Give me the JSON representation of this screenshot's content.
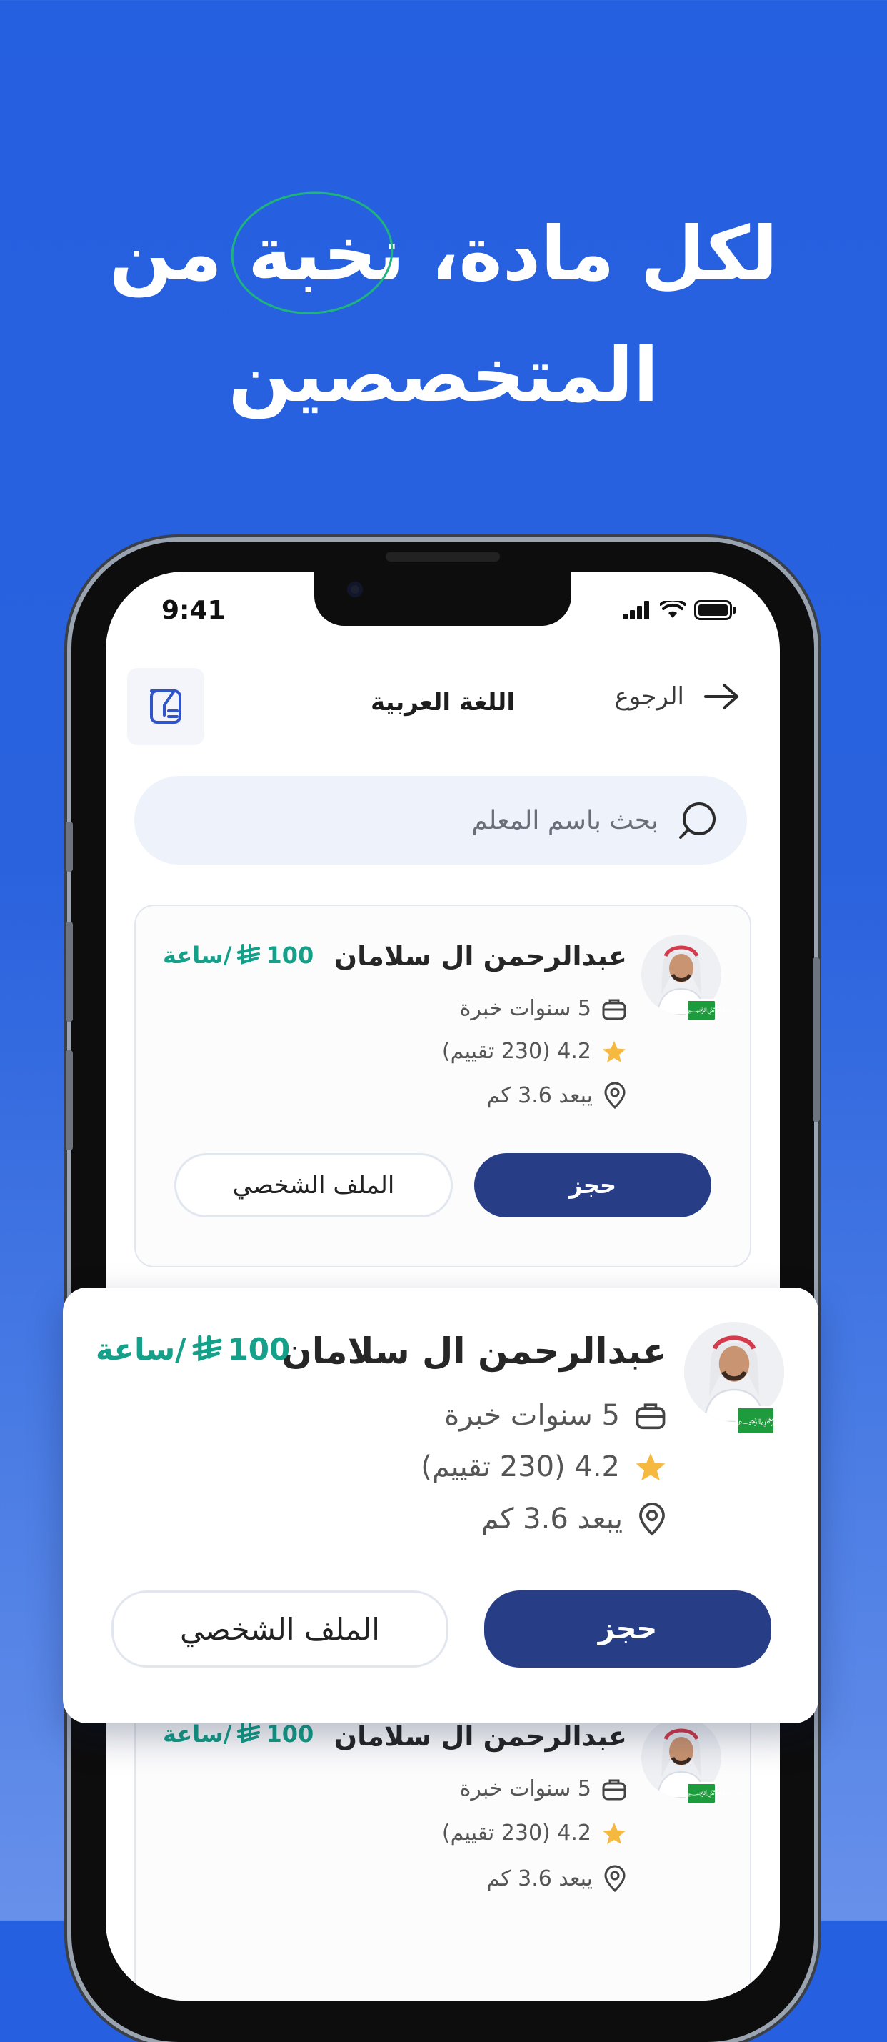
{
  "headline": {
    "line1_a": "لكل مادة، ",
    "line1_circled": "نخبة",
    "line1_b": " من",
    "line2": "المتخصصين"
  },
  "status_bar": {
    "time": "9:41"
  },
  "header": {
    "back_label": "الرجوع",
    "title": "اللغة العربية"
  },
  "search": {
    "placeholder": "بحث باسم المعلم"
  },
  "tutors": [
    {
      "name": "عبدالرحمن ال سلامان",
      "price": "100",
      "per_hour": "/ساعة",
      "experience": "5 سنوات خبرة",
      "rating": "4.2 (230 تقييم)",
      "distance": "يبعد 3.6 كم",
      "book_label": "حجز",
      "profile_label": "الملف الشخصي"
    },
    {
      "name": "عبدالرحمن ال سلامان",
      "price": "100",
      "per_hour": "/ساعة",
      "experience": "5 سنوات خبرة",
      "rating": "4.2 (230 تقييم)",
      "distance": "يبعد 3.6 كم",
      "book_label": "حجز",
      "profile_label": "الملف الشخصي"
    },
    {
      "name": "عبدالرحمن ال سلامان",
      "price": "100",
      "per_hour": "/ساعة",
      "experience": "5 سنوات خبرة",
      "rating": "4.2 (230 تقييم)",
      "distance": "يبعد 3.6 كم",
      "book_label": "حجز",
      "profile_label": "الملف الشخصي"
    }
  ],
  "colors": {
    "background": "#2560E0",
    "primary_button": "#273D86",
    "price": "#15A089",
    "star": "#F5B940",
    "flag": "#1E9B3C"
  },
  "icons": [
    "back-arrow-icon",
    "filter-icon",
    "search-icon",
    "briefcase-icon",
    "star-icon",
    "location-pin-icon",
    "riyal-icon",
    "saudi-flag-icon"
  ]
}
